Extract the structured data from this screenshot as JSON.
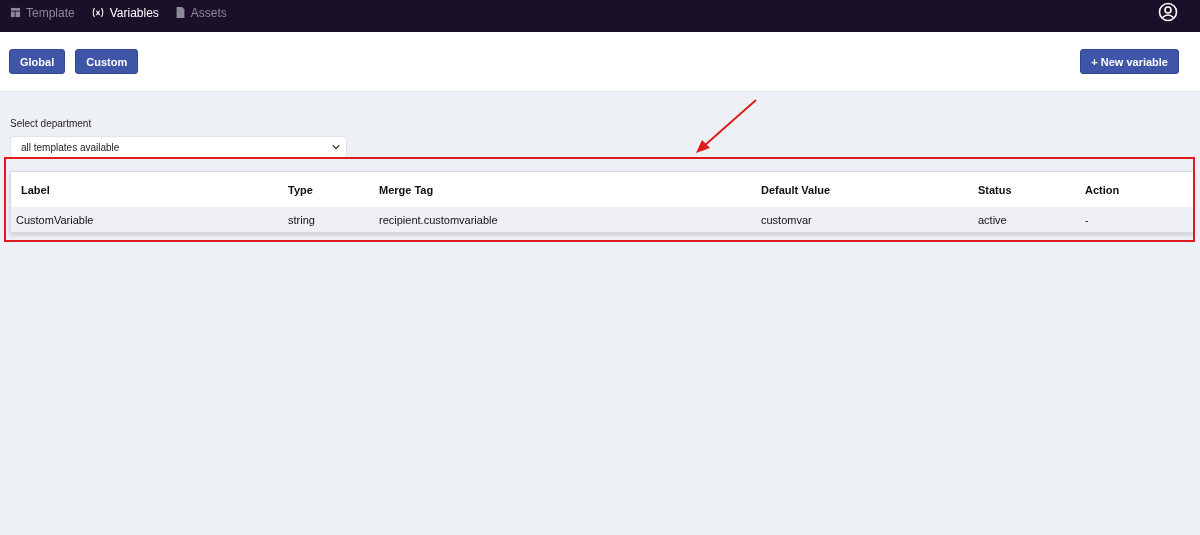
{
  "nav": {
    "tabs": [
      {
        "label": "Template",
        "kind": "layout",
        "selected": false
      },
      {
        "label": "Variables",
        "kind": "variable",
        "selected": true
      },
      {
        "label": "Assets",
        "kind": "file",
        "selected": false
      }
    ]
  },
  "toolbar": {
    "filters": [
      {
        "label": "Global"
      },
      {
        "label": "Custom"
      }
    ],
    "new_button": "+ New variable"
  },
  "department": {
    "label": "Select department",
    "value": "all templates available"
  },
  "table": {
    "columns": [
      "Label",
      "Type",
      "Merge Tag",
      "Default Value",
      "Status",
      "Action"
    ],
    "rows": [
      [
        "CustomVariable",
        "string",
        "recipient.customvariable",
        "customvar",
        "active",
        "-"
      ]
    ]
  }
}
